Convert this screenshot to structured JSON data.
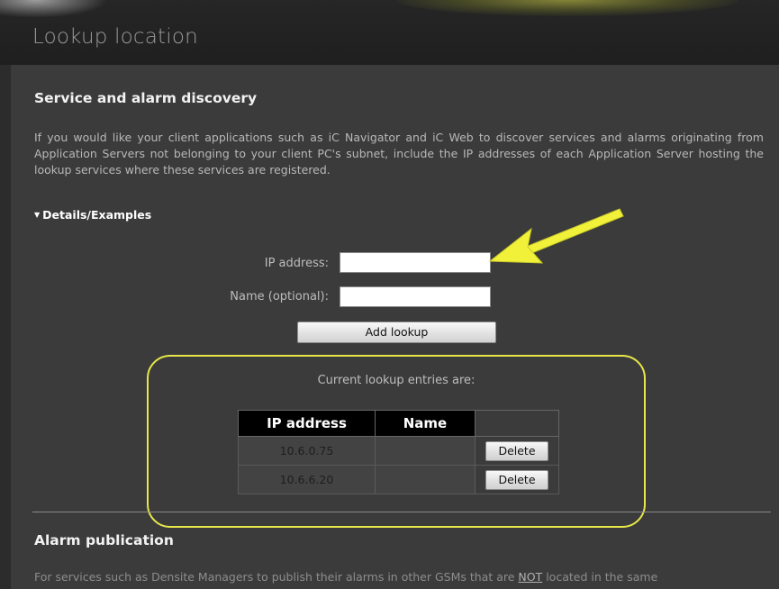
{
  "page": {
    "title": "Lookup location"
  },
  "discovery": {
    "heading": "Service and alarm discovery",
    "description": "If you would like your client applications such as iC Navigator and iC Web to discover services and alarms originating from Application Servers not belonging to your client PC's subnet, include the IP addresses of each Application Server hosting the lookup services where these services are registered.",
    "details_label": "Details/Examples",
    "details_icon": "triangle-down-icon"
  },
  "form": {
    "ip_label": "IP address:",
    "ip_value": "",
    "name_label": "Name (optional):",
    "name_value": "",
    "add_button": "Add lookup"
  },
  "entries": {
    "caption": "Current lookup entries are:",
    "columns": [
      "IP address",
      "Name",
      ""
    ],
    "rows": [
      {
        "ip": "10.6.0.75",
        "name": "",
        "action": "Delete"
      },
      {
        "ip": "10.6.6.20",
        "name": "",
        "action": "Delete"
      }
    ]
  },
  "publication": {
    "heading": "Alarm publication",
    "description_visible": "For services such as Densite Managers to publish their alarms in other GSMs that are ",
    "description_emphasis": "NOT",
    "description_tail": " located in the same"
  },
  "annotations": {
    "highlight_color": "#e7e74a",
    "arrow_color": "#f1f13a"
  }
}
